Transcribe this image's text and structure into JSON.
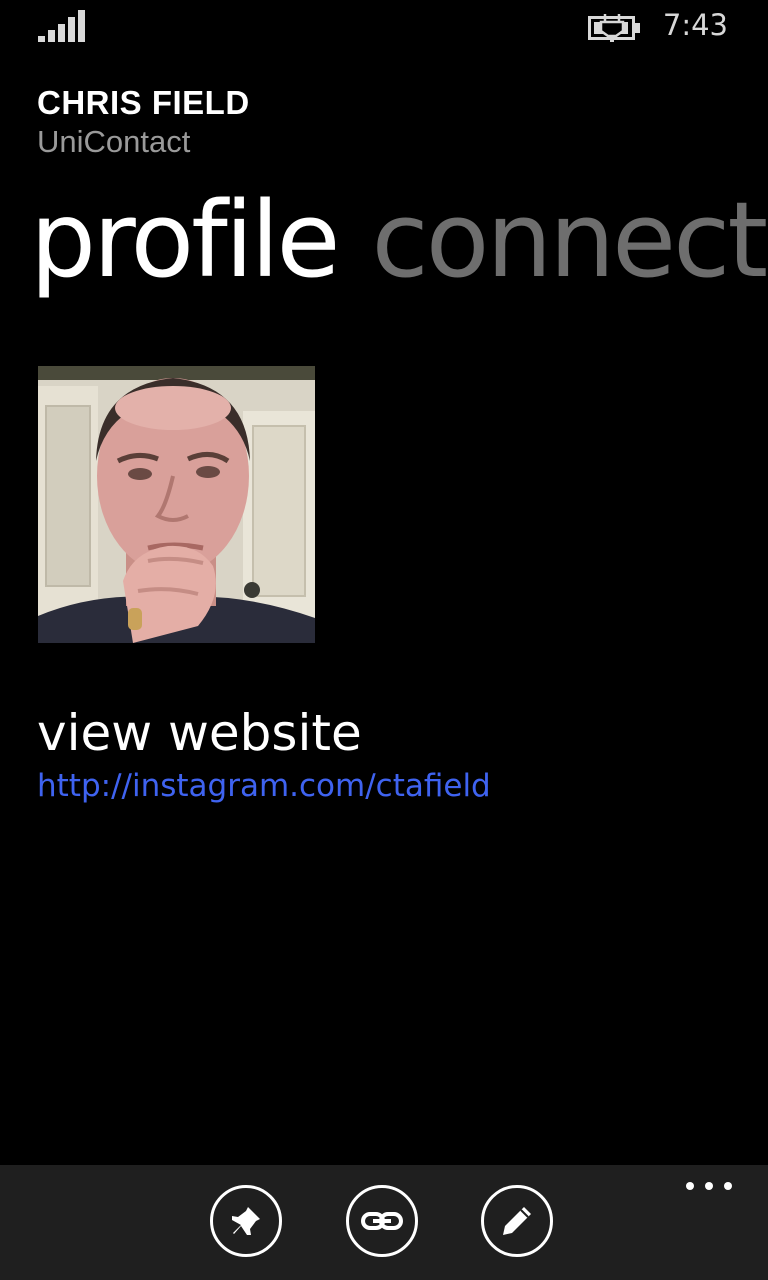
{
  "status_bar": {
    "time": "7:43",
    "signal_icon": "signal-strength-icon",
    "battery_icon": "battery-charging-icon"
  },
  "header": {
    "contact_name": "CHRIS FIELD",
    "app_name": "UniContact"
  },
  "pivot": {
    "tabs": [
      {
        "label": "profile",
        "active": true
      },
      {
        "label": "connect",
        "active": false
      }
    ]
  },
  "profile": {
    "photo_icon": "profile-photo",
    "website_label": "view website",
    "website_url": "http://instagram.com/ctafield"
  },
  "app_bar": {
    "buttons": [
      {
        "icon": "pin-icon"
      },
      {
        "icon": "link-icon"
      },
      {
        "icon": "edit-icon"
      }
    ],
    "more_icon": "more-ellipsis-icon"
  },
  "colors": {
    "background": "#000000",
    "link": "#3f63f0",
    "inactive_pivot": "#6e6e6e",
    "app_bar": "#1f1f1f"
  }
}
